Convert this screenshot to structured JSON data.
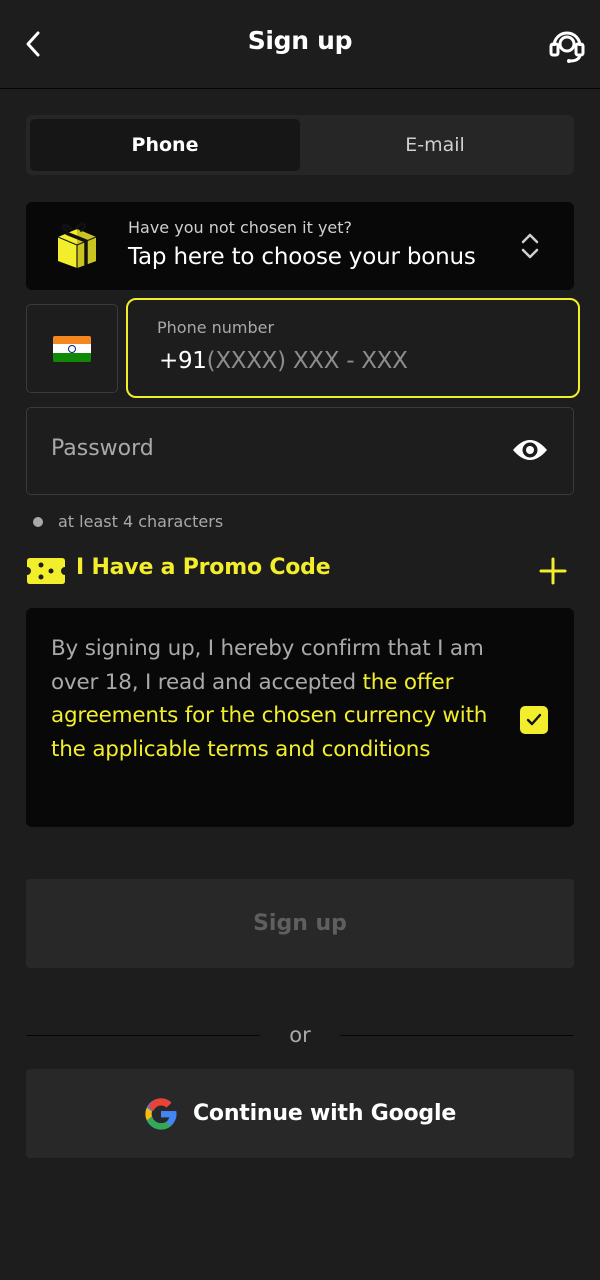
{
  "header": {
    "title": "Sign up",
    "back_icon": "chevron-left-icon",
    "support_icon": "headset-support-icon"
  },
  "tabs": [
    {
      "label": "Phone",
      "active": true
    },
    {
      "label": "E-mail",
      "active": false
    }
  ],
  "bonus": {
    "caption": "Have you not chosen it yet?",
    "main": "Tap here to choose your bonus",
    "icon": "gift-icon"
  },
  "phone": {
    "country_flag": "india-flag-icon",
    "label": "Phone number",
    "code": "+91",
    "mask": "(XXXX) XXX - XXX"
  },
  "password": {
    "placeholder": "Password",
    "icon": "eye-icon",
    "hint": "at least 4 characters"
  },
  "promo": {
    "label": "I Have a Promo Code",
    "icon": "ticket-icon",
    "expand_icon": "plus-icon"
  },
  "terms": {
    "text_before": "By signing up, I hereby confirm that I am over 18, I read and accepted ",
    "link": "the offer agreements for the chosen currency with the applicable terms and conditions",
    "checked": true
  },
  "signup_button": "Sign up",
  "divider": "or",
  "google_button": "Continue with Google",
  "colors": {
    "accent": "#f2ee2c",
    "background": "#1d1d1d",
    "panel": "#080808"
  }
}
